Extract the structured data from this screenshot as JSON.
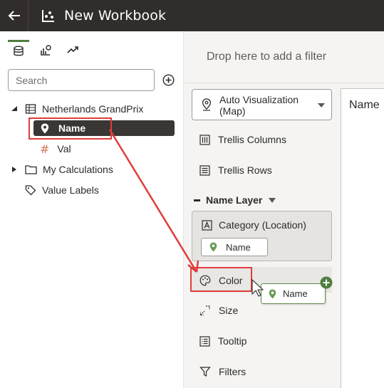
{
  "header": {
    "title": "New Workbook",
    "back_icon": "arrow-left-icon",
    "workbook_icon": "workbook-chart-icon"
  },
  "data_panel": {
    "tabs": [
      {
        "icon": "database-icon",
        "active": true
      },
      {
        "icon": "visualizations-icon",
        "active": false
      },
      {
        "icon": "analytics-icon",
        "active": false
      }
    ],
    "search": {
      "placeholder": "Search"
    },
    "tree": {
      "dataset": {
        "label": "Netherlands GrandPrix"
      },
      "fields": [
        {
          "label": "Name",
          "icon": "location-pin-icon",
          "selected": true
        },
        {
          "label": "Val",
          "icon": "hash-icon",
          "selected": false
        }
      ],
      "folders": [
        {
          "label": "My Calculations",
          "icon": "folder-icon"
        },
        {
          "label": "Value Labels",
          "icon": "tag-icon"
        }
      ]
    }
  },
  "filter_bar": {
    "placeholder": "Drop here to add a filter"
  },
  "grammar": {
    "viz_type": "Auto Visualization (Map)",
    "trellis_columns": "Trellis Columns",
    "trellis_rows": "Trellis Rows",
    "layer": "Name Layer",
    "category": "Category (Location)",
    "category_pill": "Name",
    "color": "Color",
    "size": "Size",
    "tooltip": "Tooltip",
    "filters": "Filters"
  },
  "drag": {
    "label": "Name"
  },
  "canvas": {
    "label": "Name"
  },
  "colors": {
    "topbar": "#312d2a",
    "accent_green": "#4f7d3f",
    "highlight_red": "#e03d3d",
    "hash_orange": "#d4785a"
  }
}
